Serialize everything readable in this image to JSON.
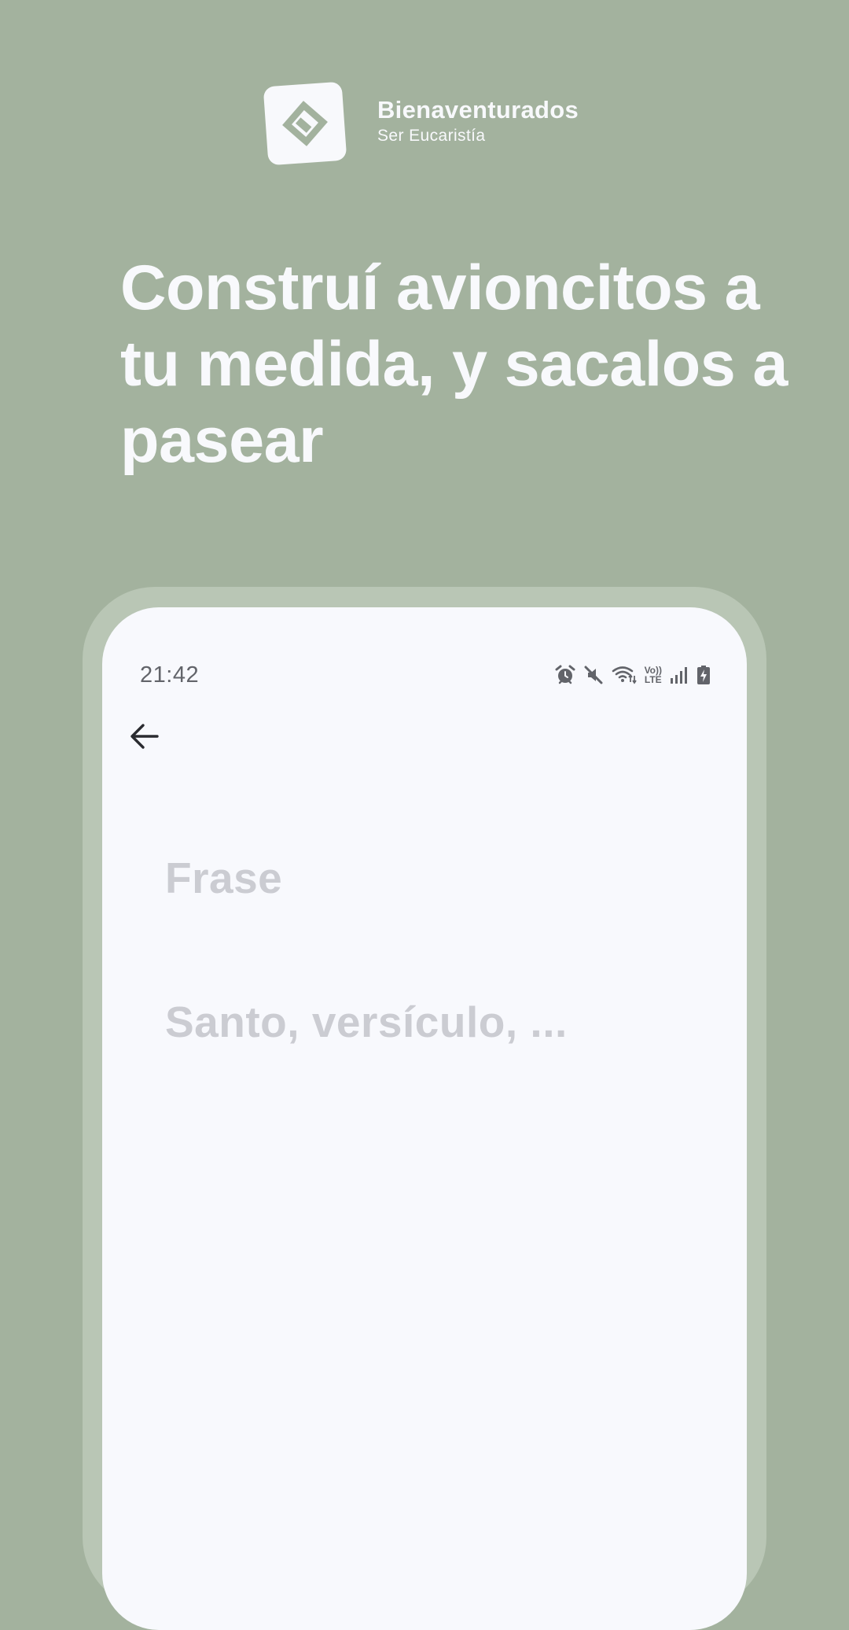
{
  "brand": {
    "name": "Bienaventurados",
    "tagline": "Ser Eucaristía"
  },
  "headline": "Construí avioncitos a tu medida, y sacalos a pasear",
  "phone": {
    "status_bar": {
      "time": "21:42",
      "volte_top": "Vo))",
      "volte_bottom": "LTE",
      "icons": [
        "alarm-icon",
        "mute-icon",
        "wifi-icon",
        "volte-icon",
        "signal-icon",
        "battery-charging-icon"
      ]
    },
    "nav": {
      "back_icon": "arrow-left-icon"
    },
    "form": {
      "phrase_placeholder": "Frase",
      "source_placeholder": "Santo, versículo, ..."
    }
  },
  "colors": {
    "background": "#a3b29e",
    "frame": "#b9c6b5",
    "screen": "#f8f9fd",
    "placeholder": "#cbccd2",
    "status": "#62646a"
  }
}
